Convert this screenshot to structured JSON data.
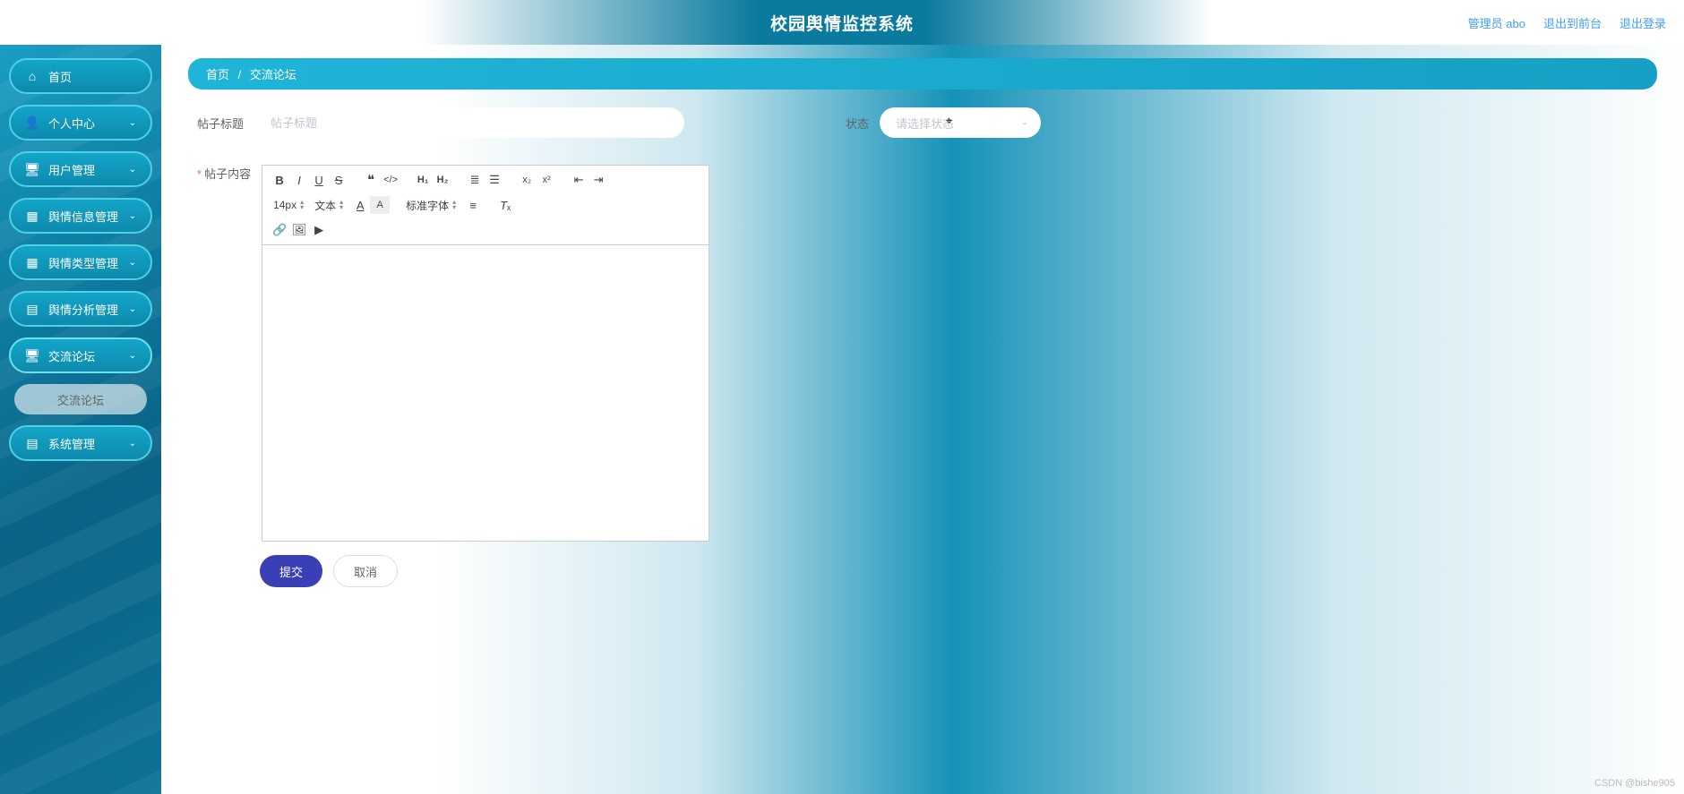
{
  "header": {
    "title": "校园舆情监控系统",
    "links": {
      "admin": "管理员 abo",
      "exit_front": "退出到前台",
      "logout": "退出登录"
    }
  },
  "sidebar": {
    "items": [
      {
        "label": "首页",
        "icon": "home",
        "expandable": false
      },
      {
        "label": "个人中心",
        "icon": "user",
        "expandable": true
      },
      {
        "label": "用户管理",
        "icon": "monitor",
        "expandable": true
      },
      {
        "label": "舆情信息管理",
        "icon": "grid",
        "expandable": true
      },
      {
        "label": "舆情类型管理",
        "icon": "grid",
        "expandable": true
      },
      {
        "label": "舆情分析管理",
        "icon": "doc",
        "expandable": true
      },
      {
        "label": "交流论坛",
        "icon": "monitor",
        "expandable": true,
        "active": true
      },
      {
        "label": "系统管理",
        "icon": "doc",
        "expandable": true
      }
    ],
    "sub": {
      "label": "交流论坛"
    }
  },
  "breadcrumb": {
    "home": "首页",
    "sep": "/",
    "current": "交流论坛"
  },
  "form": {
    "title_label": "帖子标题",
    "title_placeholder": "帖子标题",
    "status_label": "状态",
    "status_placeholder": "请选择状态",
    "content_label": "帖子内容"
  },
  "editor": {
    "font_size": "14px",
    "style_select": "文本",
    "font_family": "标准字体"
  },
  "buttons": {
    "submit": "提交",
    "cancel": "取消"
  },
  "watermark": "CSDN @bishe905"
}
